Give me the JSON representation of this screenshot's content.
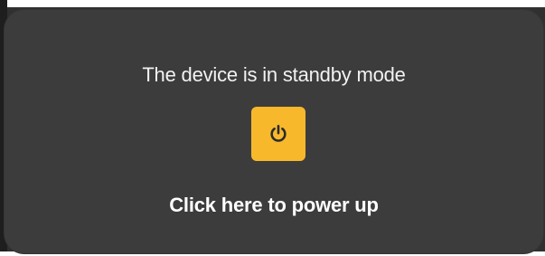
{
  "standby_panel": {
    "message": "The device is in standby mode",
    "power_button": {
      "icon": "power-icon",
      "color": "#f7b82c"
    },
    "caption": "Click here to power up"
  },
  "colors": {
    "panel_background": "#3c3c3c",
    "text": "#f2f2f2",
    "accent": "#f7b82c"
  }
}
